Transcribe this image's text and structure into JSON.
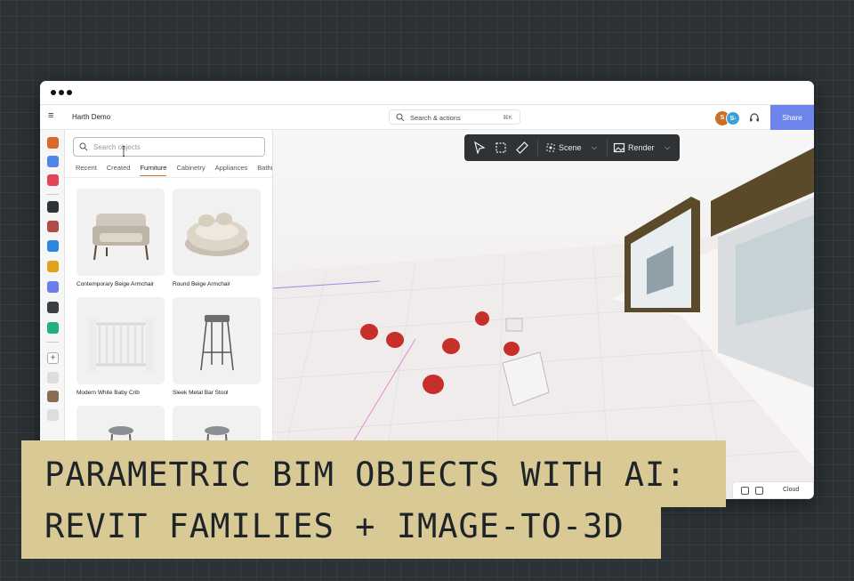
{
  "app": {
    "project_name": "Harth Demo",
    "search": {
      "label": "Search & actions",
      "shortcut": "⌘K"
    },
    "share_label": "Share",
    "avatars": [
      "S",
      "S-"
    ]
  },
  "panel": {
    "search_placeholder": "Search objects",
    "tabs": [
      {
        "label": "Recent",
        "active": false
      },
      {
        "label": "Created",
        "active": false
      },
      {
        "label": "Furniture",
        "active": true
      },
      {
        "label": "Cabinetry",
        "active": false
      },
      {
        "label": "Appliances",
        "active": false
      },
      {
        "label": "Bathro",
        "active": false
      }
    ],
    "items": [
      {
        "label": "Contemporary Beige Armchair"
      },
      {
        "label": "Round Beige Armchair"
      },
      {
        "label": "Modern White Baby Crib"
      },
      {
        "label": "Sleek Metal Bar Stool"
      },
      {
        "label": ""
      },
      {
        "label": ""
      }
    ]
  },
  "toolbar": {
    "scene_label": "Scene",
    "render_label": "Render"
  },
  "viewport_footer": {
    "cloud_label": "Cloud"
  },
  "banner": {
    "line1": "PARAMETRIC BIM OBJECTS WITH AI:",
    "line2": "REVIT FAMILIES + IMAGE-TO-3D"
  },
  "colors": {
    "share": "#6d84ea",
    "accent": "#c8702a",
    "banner": "#d8c995",
    "toolbar": "#2f3336"
  }
}
